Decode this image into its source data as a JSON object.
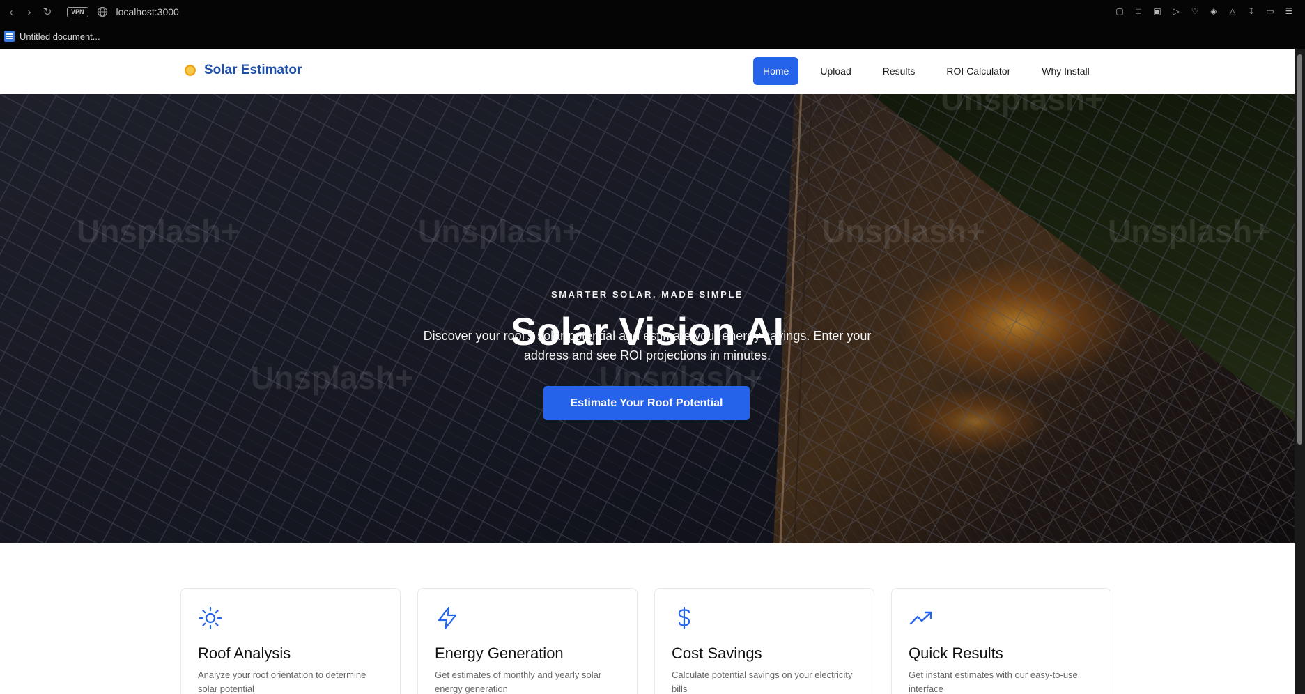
{
  "browser": {
    "url": "localhost:3000",
    "vpn_label": "VPN",
    "bookmark": "Untitled document..."
  },
  "site": {
    "brand": "Solar Estimator",
    "nav": [
      {
        "label": "Home",
        "active": true
      },
      {
        "label": "Upload",
        "active": false
      },
      {
        "label": "Results",
        "active": false
      },
      {
        "label": "ROI Calculator",
        "active": false
      },
      {
        "label": "Why Install",
        "active": false
      }
    ]
  },
  "hero": {
    "eyebrow": "SMARTER SOLAR, MADE SIMPLE",
    "title": "Solar Vision AI",
    "subtitle": "Discover your roof's solar potential and estimate your energy savings. Enter your address and see ROI projections in minutes.",
    "cta": "Estimate Your Roof Potential",
    "watermark": "Unsplash+"
  },
  "features": [
    {
      "icon": "sun-icon",
      "title": "Roof Analysis",
      "desc": "Analyze your roof orientation to determine solar potential"
    },
    {
      "icon": "lightning-icon",
      "title": "Energy Generation",
      "desc": "Get estimates of monthly and yearly solar energy generation"
    },
    {
      "icon": "dollar-icon",
      "title": "Cost Savings",
      "desc": "Calculate potential savings on your electricity bills"
    },
    {
      "icon": "trending-up-icon",
      "title": "Quick Results",
      "desc": "Get instant estimates with our easy-to-use interface"
    }
  ],
  "colors": {
    "accent": "#2563eb",
    "brand": "#1f4fa8"
  }
}
